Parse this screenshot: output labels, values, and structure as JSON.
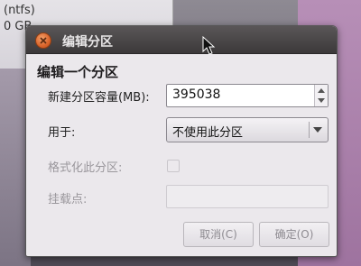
{
  "background": {
    "window_label_1": "(ntfs)",
    "window_label_2": "0 GB"
  },
  "dialog": {
    "title": "编辑分区",
    "heading": "编辑一个分区",
    "size_label": "新建分区容量(MB):",
    "size_value": "395038",
    "use_label": "用于:",
    "use_value": "不使用此分区",
    "format_label": "格式化此分区:",
    "mount_label": "挂载点:",
    "mount_value": "",
    "cancel_label": "取消(C)",
    "ok_label": "确定(O)"
  },
  "icons": {
    "close": "close-icon",
    "spin_up": "chevron-up-icon",
    "spin_down": "chevron-down-icon",
    "combo": "dropdown-arrow-icon",
    "cursor": "mouse-pointer-icon"
  },
  "colors": {
    "close_button": "#d9642b",
    "titlebar": "#3c393a",
    "dialog_bg": "#ebe8ec"
  }
}
